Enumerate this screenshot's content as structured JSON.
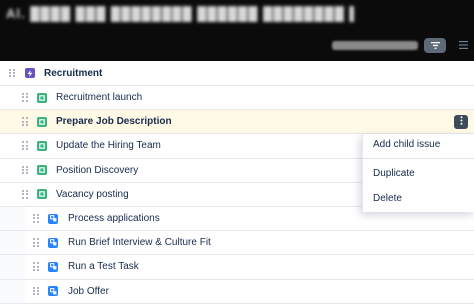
{
  "header": {
    "blurred_title": "Al. ████ ███ ████████ ██████ ████████ ▌",
    "filter_icon": "filter-icon",
    "list_icon": "list-icon"
  },
  "rows": [
    {
      "label": "Recruitment",
      "type": "epic",
      "bold": true
    },
    {
      "label": "Recruitment launch",
      "type": "story",
      "bold": false
    },
    {
      "label": "Prepare Job Description",
      "type": "story",
      "bold": true,
      "selected": true
    },
    {
      "label": "Update the Hiring Team",
      "type": "story",
      "bold": false
    },
    {
      "label": "Position Discovery",
      "type": "story",
      "bold": false
    },
    {
      "label": "Vacancy posting",
      "type": "story",
      "bold": false
    },
    {
      "label": "Process applications",
      "type": "subtask",
      "bold": false
    },
    {
      "label": "Run Brief Interview & Culture Fit",
      "type": "subtask",
      "bold": false
    },
    {
      "label": "Run a Test Task",
      "type": "subtask",
      "bold": false
    },
    {
      "label": "Job Offer",
      "type": "subtask",
      "bold": false
    }
  ],
  "menu": {
    "add_child": "Add child issue",
    "duplicate": "Duplicate",
    "delete": "Delete"
  },
  "colors": {
    "epic": "#6554c0",
    "story": "#36b37e",
    "subtask": "#2684ff",
    "selected_row": "#fff9e6",
    "header_bg": "#0b0b0b"
  }
}
